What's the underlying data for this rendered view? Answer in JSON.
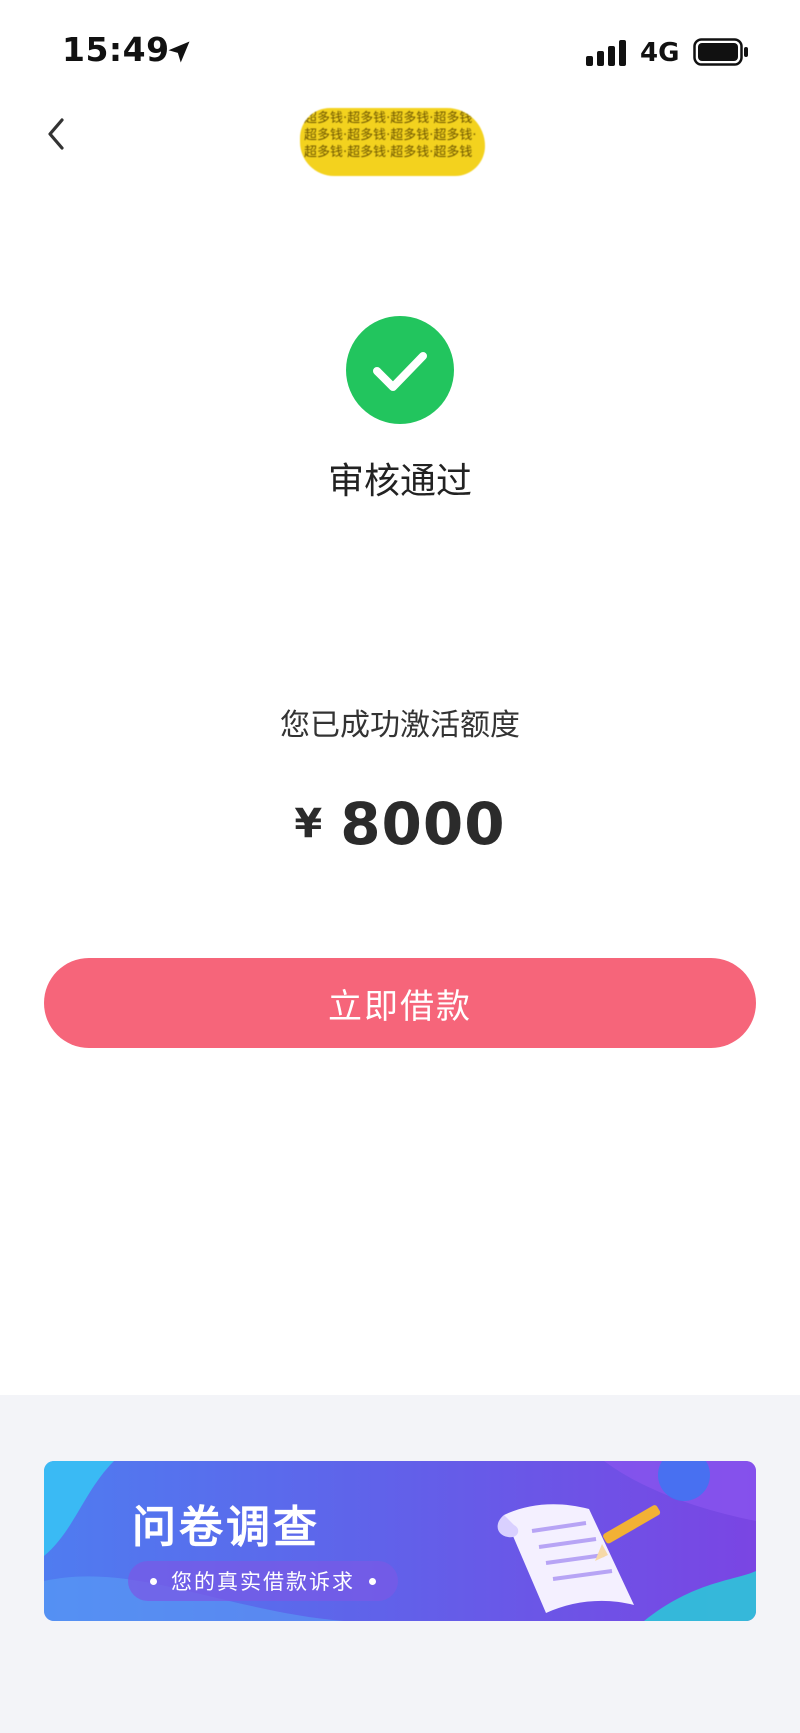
{
  "status_bar": {
    "time": "15:49",
    "location_icon": "location-arrow-icon",
    "signal_icon": "cellular-signal-icon",
    "network": "4G",
    "battery_icon": "battery-icon"
  },
  "nav": {
    "back_icon": "chevron-left-icon",
    "title_redacted_text": "超多钱·超多钱·超多钱·超多钱·超多钱·超多钱·超多钱·超多钱·超多钱·超多钱·超多钱·超多钱"
  },
  "result": {
    "icon": "check-circle-icon",
    "title": "审核通过",
    "subtitle": "您已成功激活额度",
    "currency": "¥",
    "amount": "8000"
  },
  "actions": {
    "borrow_label": "立即借款"
  },
  "banner": {
    "title": "问卷调查",
    "subtitle": "您的真实借款诉求",
    "illustration": "paper-scroll-pencil-icon"
  },
  "colors": {
    "success_green": "#22c55e",
    "button_pink": "#f6657a",
    "banner_blue": "#4f7cf0",
    "banner_purple": "#7a45e3",
    "bottom_bg": "#f3f4f8",
    "redaction_yellow": "#f3d21e"
  }
}
